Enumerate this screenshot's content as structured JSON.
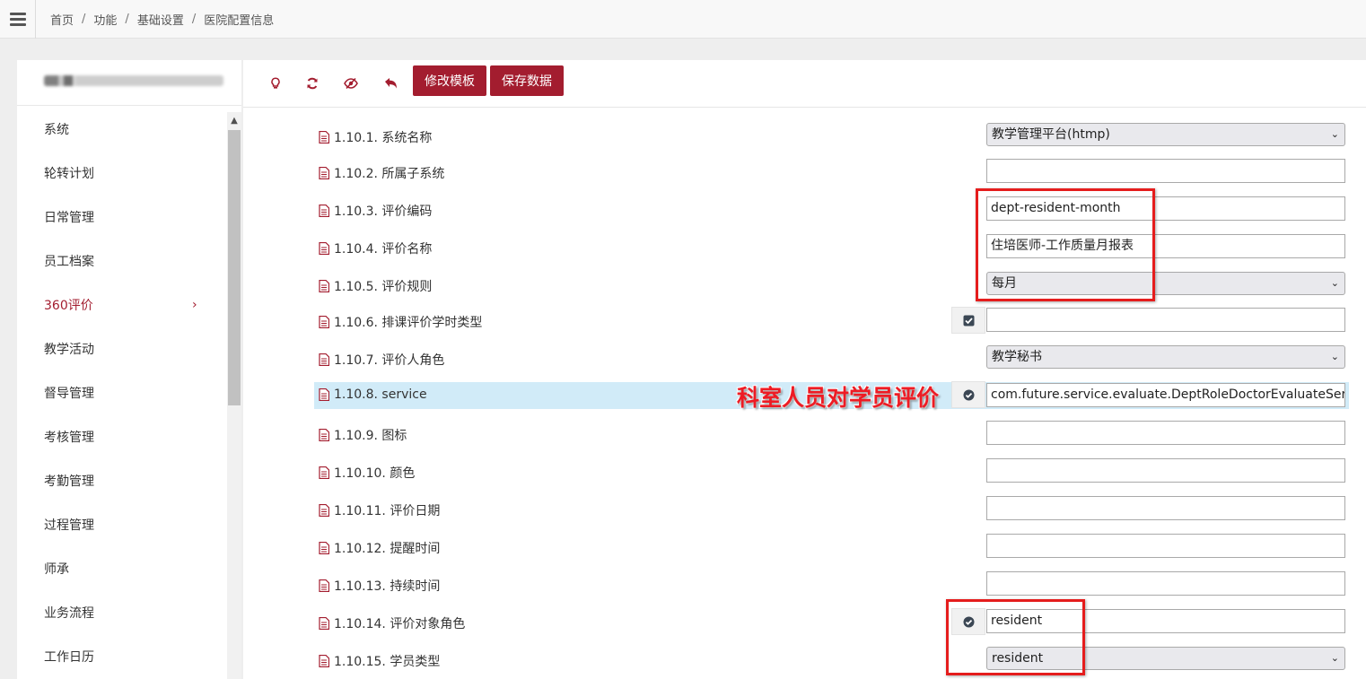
{
  "breadcrumb": [
    "首页",
    "功能",
    "基础设置",
    "医院配置信息"
  ],
  "breadcrumb_separator": "/",
  "sidebar": {
    "items": [
      {
        "label": "系统"
      },
      {
        "label": "轮转计划"
      },
      {
        "label": "日常管理"
      },
      {
        "label": "员工档案"
      },
      {
        "label": "360评价",
        "active": true
      },
      {
        "label": "教学活动"
      },
      {
        "label": "督导管理"
      },
      {
        "label": "考核管理"
      },
      {
        "label": "考勤管理"
      },
      {
        "label": "过程管理"
      },
      {
        "label": "师承"
      },
      {
        "label": "业务流程"
      },
      {
        "label": "工作日历"
      }
    ],
    "active_chevron": "›"
  },
  "toolbar": {
    "icons": [
      "lightbulb-icon",
      "refresh-icon",
      "eye-slash-icon",
      "undo-icon"
    ],
    "edit_template_label": "修改模板",
    "save_data_label": "保存数据"
  },
  "rows": [
    {
      "label": "1.10.1. 系统名称",
      "type": "select",
      "value": "教学管理平台(htmp)"
    },
    {
      "label": "1.10.2. 所属子系统",
      "type": "input",
      "value": ""
    },
    {
      "label": "1.10.3. 评价编码",
      "type": "input",
      "value": "dept-resident-month"
    },
    {
      "label": "1.10.4. 评价名称",
      "type": "input",
      "value": "住培医师-工作质量月报表"
    },
    {
      "label": "1.10.5. 评价规则",
      "type": "select",
      "value": "每月"
    },
    {
      "label": "1.10.6. 排课评价学时类型",
      "type": "input",
      "value": "",
      "check": "square-check"
    },
    {
      "label": "1.10.7. 评价人角色",
      "type": "select",
      "value": "教学秘书"
    },
    {
      "label": "1.10.8. service",
      "type": "input",
      "value": "com.future.service.evaluate.DeptRoleDoctorEvaluateService",
      "check": "circle-check",
      "highlighted": true
    },
    {
      "label": "1.10.9. 图标",
      "type": "input",
      "value": ""
    },
    {
      "label": "1.10.10. 颜色",
      "type": "input",
      "value": ""
    },
    {
      "label": "1.10.11. 评价日期",
      "type": "input",
      "value": ""
    },
    {
      "label": "1.10.12. 提醒时间",
      "type": "input",
      "value": ""
    },
    {
      "label": "1.10.13. 持续时间",
      "type": "input",
      "value": ""
    },
    {
      "label": "1.10.14. 评价对象角色",
      "type": "input",
      "value": "resident",
      "check": "circle-check"
    },
    {
      "label": "1.10.15. 学员类型",
      "type": "select",
      "value": "resident"
    }
  ],
  "annotation": "科室人员对学员评价",
  "colors": {
    "accent": "#a31d2f",
    "annotation_red": "#ee1b24",
    "highlight": "#d1ebf8"
  }
}
